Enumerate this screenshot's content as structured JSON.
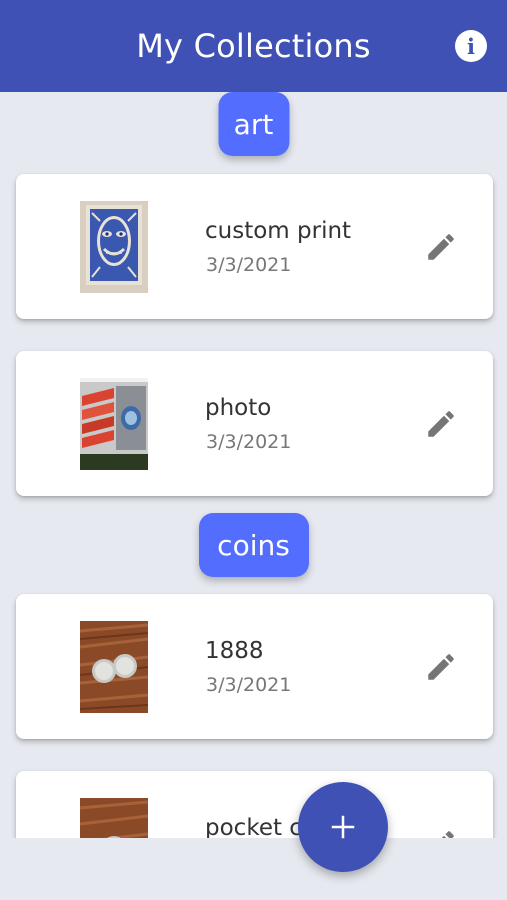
{
  "app_bar": {
    "title": "My Collections",
    "info_icon": "info-icon",
    "info_glyph": "i"
  },
  "collections": [
    {
      "label": "art",
      "items": [
        {
          "name": "custom print",
          "date": "3/3/2021",
          "thumbnail": "linocut-face-print",
          "edit_icon": "pencil-icon"
        },
        {
          "name": "photo",
          "date": "3/3/2021",
          "thumbnail": "framed-photo",
          "edit_icon": "pencil-icon"
        }
      ]
    },
    {
      "label": "coins",
      "items": [
        {
          "name": "1888",
          "date": "3/3/2021",
          "thumbnail": "two-silver-coins-on-wood",
          "edit_icon": "pencil-icon"
        },
        {
          "name": "pocket c",
          "date": "",
          "thumbnail": "coin-on-wood",
          "edit_icon": "pencil-icon"
        }
      ]
    }
  ],
  "fab": {
    "icon": "plus-icon"
  },
  "colors": {
    "app_bar": "#3f51b5",
    "chip": "#536dfe",
    "background": "#e6eaf0",
    "card": "#ffffff",
    "edit_icon": "#757575",
    "fab": "#3f51b5"
  }
}
